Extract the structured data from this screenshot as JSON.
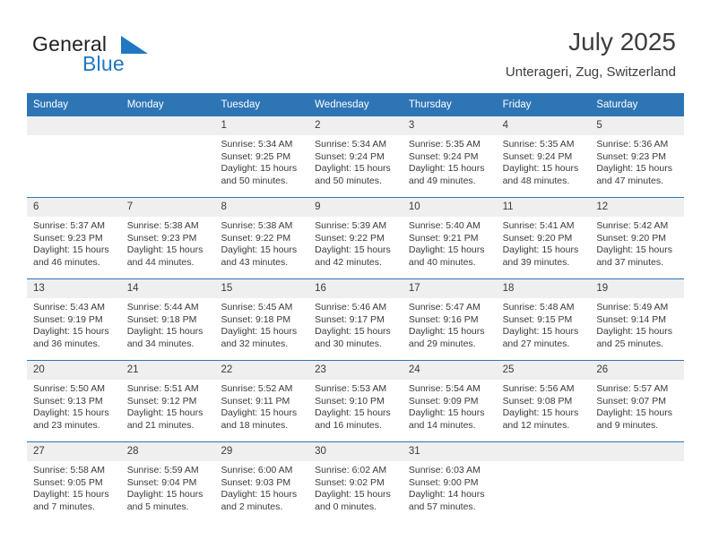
{
  "brand": {
    "name_part1": "General",
    "name_part2": "Blue",
    "accent_color": "#1f78c1"
  },
  "header": {
    "title": "July 2025",
    "location": "Unterageri, Zug, Switzerland"
  },
  "theme": {
    "header_blue": "#2e75b6",
    "date_band_gray": "#efefef",
    "text": "#3a3a3a"
  },
  "calendar": {
    "weekday_headers": [
      "Sunday",
      "Monday",
      "Tuesday",
      "Wednesday",
      "Thursday",
      "Friday",
      "Saturday"
    ],
    "weeks": [
      {
        "days": [
          {
            "date": "",
            "lines": []
          },
          {
            "date": "",
            "lines": []
          },
          {
            "date": "1",
            "lines": [
              "Sunrise: 5:34 AM",
              "Sunset: 9:25 PM",
              "Daylight: 15 hours and 50 minutes."
            ]
          },
          {
            "date": "2",
            "lines": [
              "Sunrise: 5:34 AM",
              "Sunset: 9:24 PM",
              "Daylight: 15 hours and 50 minutes."
            ]
          },
          {
            "date": "3",
            "lines": [
              "Sunrise: 5:35 AM",
              "Sunset: 9:24 PM",
              "Daylight: 15 hours and 49 minutes."
            ]
          },
          {
            "date": "4",
            "lines": [
              "Sunrise: 5:35 AM",
              "Sunset: 9:24 PM",
              "Daylight: 15 hours and 48 minutes."
            ]
          },
          {
            "date": "5",
            "lines": [
              "Sunrise: 5:36 AM",
              "Sunset: 9:23 PM",
              "Daylight: 15 hours and 47 minutes."
            ]
          }
        ]
      },
      {
        "days": [
          {
            "date": "6",
            "lines": [
              "Sunrise: 5:37 AM",
              "Sunset: 9:23 PM",
              "Daylight: 15 hours and 46 minutes."
            ]
          },
          {
            "date": "7",
            "lines": [
              "Sunrise: 5:38 AM",
              "Sunset: 9:23 PM",
              "Daylight: 15 hours and 44 minutes."
            ]
          },
          {
            "date": "8",
            "lines": [
              "Sunrise: 5:38 AM",
              "Sunset: 9:22 PM",
              "Daylight: 15 hours and 43 minutes."
            ]
          },
          {
            "date": "9",
            "lines": [
              "Sunrise: 5:39 AM",
              "Sunset: 9:22 PM",
              "Daylight: 15 hours and 42 minutes."
            ]
          },
          {
            "date": "10",
            "lines": [
              "Sunrise: 5:40 AM",
              "Sunset: 9:21 PM",
              "Daylight: 15 hours and 40 minutes."
            ]
          },
          {
            "date": "11",
            "lines": [
              "Sunrise: 5:41 AM",
              "Sunset: 9:20 PM",
              "Daylight: 15 hours and 39 minutes."
            ]
          },
          {
            "date": "12",
            "lines": [
              "Sunrise: 5:42 AM",
              "Sunset: 9:20 PM",
              "Daylight: 15 hours and 37 minutes."
            ]
          }
        ]
      },
      {
        "days": [
          {
            "date": "13",
            "lines": [
              "Sunrise: 5:43 AM",
              "Sunset: 9:19 PM",
              "Daylight: 15 hours and 36 minutes."
            ]
          },
          {
            "date": "14",
            "lines": [
              "Sunrise: 5:44 AM",
              "Sunset: 9:18 PM",
              "Daylight: 15 hours and 34 minutes."
            ]
          },
          {
            "date": "15",
            "lines": [
              "Sunrise: 5:45 AM",
              "Sunset: 9:18 PM",
              "Daylight: 15 hours and 32 minutes."
            ]
          },
          {
            "date": "16",
            "lines": [
              "Sunrise: 5:46 AM",
              "Sunset: 9:17 PM",
              "Daylight: 15 hours and 30 minutes."
            ]
          },
          {
            "date": "17",
            "lines": [
              "Sunrise: 5:47 AM",
              "Sunset: 9:16 PM",
              "Daylight: 15 hours and 29 minutes."
            ]
          },
          {
            "date": "18",
            "lines": [
              "Sunrise: 5:48 AM",
              "Sunset: 9:15 PM",
              "Daylight: 15 hours and 27 minutes."
            ]
          },
          {
            "date": "19",
            "lines": [
              "Sunrise: 5:49 AM",
              "Sunset: 9:14 PM",
              "Daylight: 15 hours and 25 minutes."
            ]
          }
        ]
      },
      {
        "days": [
          {
            "date": "20",
            "lines": [
              "Sunrise: 5:50 AM",
              "Sunset: 9:13 PM",
              "Daylight: 15 hours and 23 minutes."
            ]
          },
          {
            "date": "21",
            "lines": [
              "Sunrise: 5:51 AM",
              "Sunset: 9:12 PM",
              "Daylight: 15 hours and 21 minutes."
            ]
          },
          {
            "date": "22",
            "lines": [
              "Sunrise: 5:52 AM",
              "Sunset: 9:11 PM",
              "Daylight: 15 hours and 18 minutes."
            ]
          },
          {
            "date": "23",
            "lines": [
              "Sunrise: 5:53 AM",
              "Sunset: 9:10 PM",
              "Daylight: 15 hours and 16 minutes."
            ]
          },
          {
            "date": "24",
            "lines": [
              "Sunrise: 5:54 AM",
              "Sunset: 9:09 PM",
              "Daylight: 15 hours and 14 minutes."
            ]
          },
          {
            "date": "25",
            "lines": [
              "Sunrise: 5:56 AM",
              "Sunset: 9:08 PM",
              "Daylight: 15 hours and 12 minutes."
            ]
          },
          {
            "date": "26",
            "lines": [
              "Sunrise: 5:57 AM",
              "Sunset: 9:07 PM",
              "Daylight: 15 hours and 9 minutes."
            ]
          }
        ]
      },
      {
        "days": [
          {
            "date": "27",
            "lines": [
              "Sunrise: 5:58 AM",
              "Sunset: 9:05 PM",
              "Daylight: 15 hours and 7 minutes."
            ]
          },
          {
            "date": "28",
            "lines": [
              "Sunrise: 5:59 AM",
              "Sunset: 9:04 PM",
              "Daylight: 15 hours and 5 minutes."
            ]
          },
          {
            "date": "29",
            "lines": [
              "Sunrise: 6:00 AM",
              "Sunset: 9:03 PM",
              "Daylight: 15 hours and 2 minutes."
            ]
          },
          {
            "date": "30",
            "lines": [
              "Sunrise: 6:02 AM",
              "Sunset: 9:02 PM",
              "Daylight: 15 hours and 0 minutes."
            ]
          },
          {
            "date": "31",
            "lines": [
              "Sunrise: 6:03 AM",
              "Sunset: 9:00 PM",
              "Daylight: 14 hours and 57 minutes."
            ]
          },
          {
            "date": "",
            "lines": []
          },
          {
            "date": "",
            "lines": []
          }
        ]
      }
    ]
  }
}
